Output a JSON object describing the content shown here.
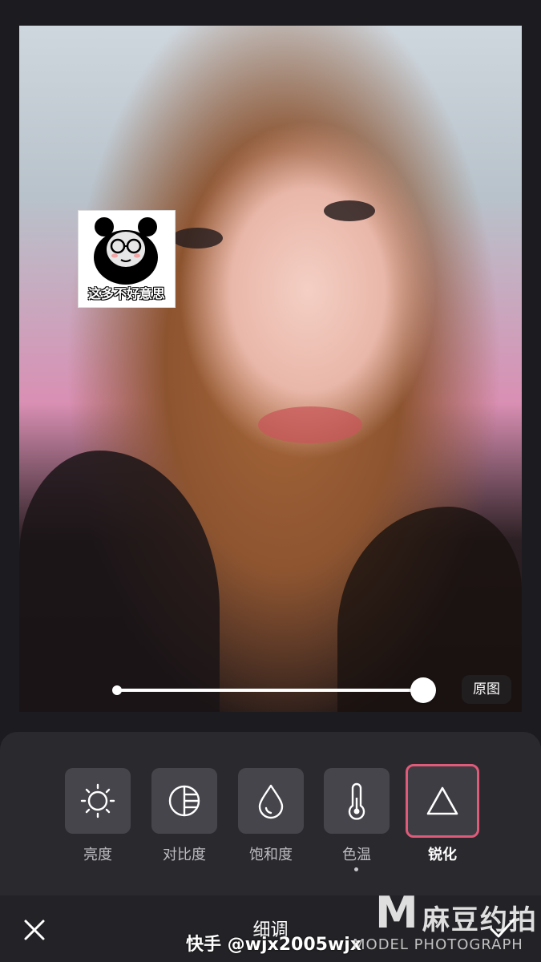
{
  "photo": {
    "sticker_caption": "这多不好意思"
  },
  "slider": {
    "value_fraction": 1.0
  },
  "compare_button_label": "原图",
  "tools": [
    {
      "label": "亮度",
      "icon": "sun-icon"
    },
    {
      "label": "对比度",
      "icon": "contrast-icon"
    },
    {
      "label": "饱和度",
      "icon": "droplet-icon"
    },
    {
      "label": "色温",
      "icon": "thermometer-icon"
    },
    {
      "label": "锐化",
      "icon": "triangle-icon",
      "selected": true
    }
  ],
  "accent_color": "#e05a7a",
  "footer": {
    "title": "细调",
    "close_icon": "close-icon",
    "confirm_icon": "check-icon"
  },
  "watermarks": {
    "user": "快手 @wjx2005wjx",
    "brand_letter": "M",
    "brand_cn": "麻豆约拍",
    "brand_en": "MODEL PHOTOGRAPH"
  }
}
